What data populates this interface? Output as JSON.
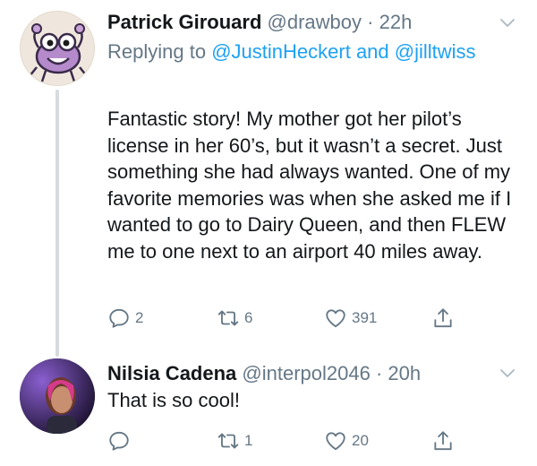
{
  "tweets": [
    {
      "display_name": "Patrick Girouard",
      "handle": "@drawboy",
      "separator": "·",
      "time": "22h",
      "reply_prefix": "Replying to",
      "reply_mentions": [
        "@JustinHeckert",
        "and",
        "@jilltwiss"
      ],
      "text": "Fantastic story! My mother got her pilot’s license in her 60’s, but it wasn’t a secret. Just something she had always wanted. One of my favorite memories was when she asked me if I wanted to go to Dairy Queen, and then FLEW me to one next to an airport 40 miles away.",
      "replies": "2",
      "retweets": "6",
      "likes": "391",
      "avatar_icon": "cartoon-bug-avatar"
    },
    {
      "display_name": "Nilsia Cadena",
      "handle": "@interpol2046",
      "separator": "·",
      "time": "20h",
      "text": "That is so cool!",
      "replies": "",
      "retweets": "1",
      "likes": "20",
      "avatar_icon": "photo-avatar"
    }
  ],
  "colors": {
    "text": "#14171a",
    "secondary": "#657786",
    "link": "#1da1f2",
    "thread_line": "#d6dbe0"
  }
}
